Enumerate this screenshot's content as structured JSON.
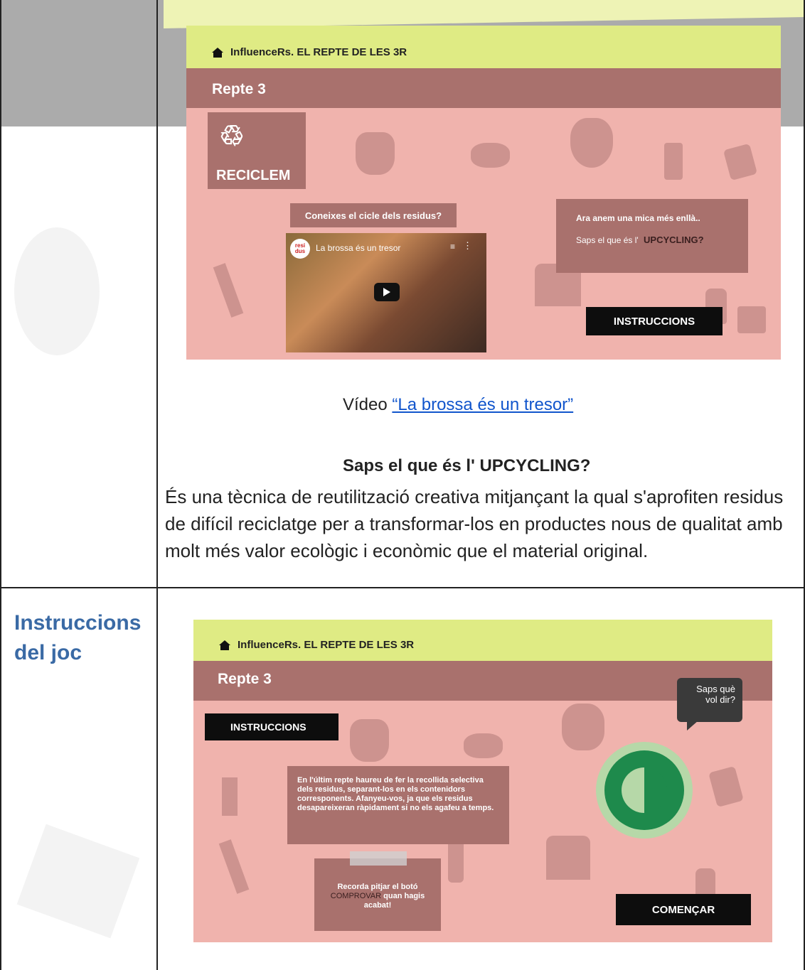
{
  "shot1": {
    "app_title": "InfluenceRs. EL REPTE DE LES 3R",
    "repte": "Repte 3",
    "reciclem": "RECICLEM",
    "cicle_question": "Coneixes el cicle dels residus?",
    "video_title": "La brossa és un tresor",
    "video_channel_badge": "resi dus",
    "upcycling_line1": "Ara anem una mica més enllà..",
    "upcycling_line2_prefix": "Saps el que és l'",
    "upcycling_line2_word": "UPCYCLING?",
    "instructions_button": "INSTRUCCIONS"
  },
  "caption": {
    "prefix": "Vídeo ",
    "link_text": "“La brossa és un tresor”"
  },
  "upcycling": {
    "heading": "Saps el que és l' UPCYCLING?",
    "body": "És una tècnica de reutilització creativa mitjançant la qual s'aprofiten residus de difícil reciclatge per a transformar-los en productes nous de qualitat amb molt més valor ecològic i econòmic que el material original."
  },
  "row2": {
    "side_label": "Instruccions del joc"
  },
  "shot2": {
    "app_title": "InfluenceRs. EL REPTE DE LES 3R",
    "repte": "Repte 3",
    "instructions_label": "INSTRUCCIONS",
    "bubble_text": "Saps què vol dir?",
    "instructions_text": "En l'últim repte haureu de fer la recollida selectiva dels residus, separant-los en els contenidors corresponents. Afanyeu-vos, ja que els residus desapareixeran ràpidament si no els agafeu a temps.",
    "reminder_prefix": "Recorda pitjar el botó ",
    "reminder_word": "COMPROVAR",
    "reminder_suffix": " quan hagis acabat!",
    "start_button": "COMENÇAR"
  },
  "colors": {
    "shot_bg": "#f0b3ad",
    "brown_band": "#a9716d",
    "top_bar": "#dfeb84",
    "link": "#1155cc",
    "side_heading": "#3a6aa5",
    "green_dot": "#1e8a4c"
  }
}
